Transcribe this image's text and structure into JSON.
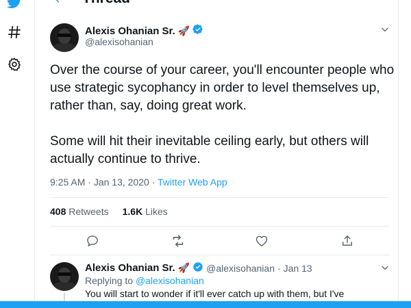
{
  "colors": {
    "accent": "#1da1f2",
    "secondary_text": "#536471",
    "primary_text": "#0f1419"
  },
  "header": {
    "title": "Thread"
  },
  "tweet": {
    "author_name": "Alexis Ohanian Sr.",
    "author_emoji": "🚀",
    "handle": "@alexisohanian",
    "paragraph_1": "Over the course of your career, you'll encounter people who use strategic sycophancy in order to level themselves up, rather than, say, doing great work.",
    "paragraph_2": "Some will hit their inevitable ceiling early, but others will actually continue to thrive.",
    "time": "9:25 AM",
    "date": "Jan 13, 2020",
    "separator": "·",
    "app": "Twitter Web App",
    "retweets_count": "408",
    "retweets_label": "Retweets",
    "likes_count": "1.6K",
    "likes_label": "Likes"
  },
  "reply": {
    "author_name": "Alexis Ohanian Sr.",
    "author_emoji": "🚀",
    "handle": "@alexisohanian",
    "separator": "·",
    "date": "Jan 13",
    "replying_label": "Replying to",
    "replying_to": "@alexisohanian",
    "text": "You will start to wonder if it'll ever catch up with them, but I've"
  },
  "icons": {
    "rail": [
      "twitter-bird-icon",
      "hashtag-icon",
      "settings-icon"
    ],
    "actions": [
      "reply-icon",
      "retweet-icon",
      "like-icon",
      "share-icon"
    ]
  }
}
